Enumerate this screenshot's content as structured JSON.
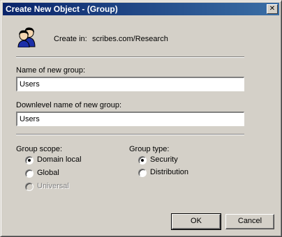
{
  "window": {
    "title": "Create New Object - (Group)",
    "close_glyph": "✕",
    "title_bar_color": "#0a246a"
  },
  "header": {
    "icon": "group-users-icon",
    "create_in_label": "Create in:",
    "create_in_path": "scribes.com/Research"
  },
  "form": {
    "group_name_label": "Name of new group:",
    "group_name_value": "Users",
    "downlevel_name_label": "Downlevel name of new group:",
    "downlevel_name_value": "Users"
  },
  "group_scope": {
    "label": "Group scope:",
    "options": [
      {
        "label": "Domain local",
        "checked": true,
        "enabled": true
      },
      {
        "label": "Global",
        "checked": false,
        "enabled": true
      },
      {
        "label": "Universal",
        "checked": false,
        "enabled": false
      }
    ]
  },
  "group_type": {
    "label": "Group type:",
    "options": [
      {
        "label": "Security",
        "checked": true,
        "enabled": true
      },
      {
        "label": "Distribution",
        "checked": false,
        "enabled": true
      }
    ]
  },
  "buttons": {
    "ok": "OK",
    "cancel": "Cancel"
  }
}
